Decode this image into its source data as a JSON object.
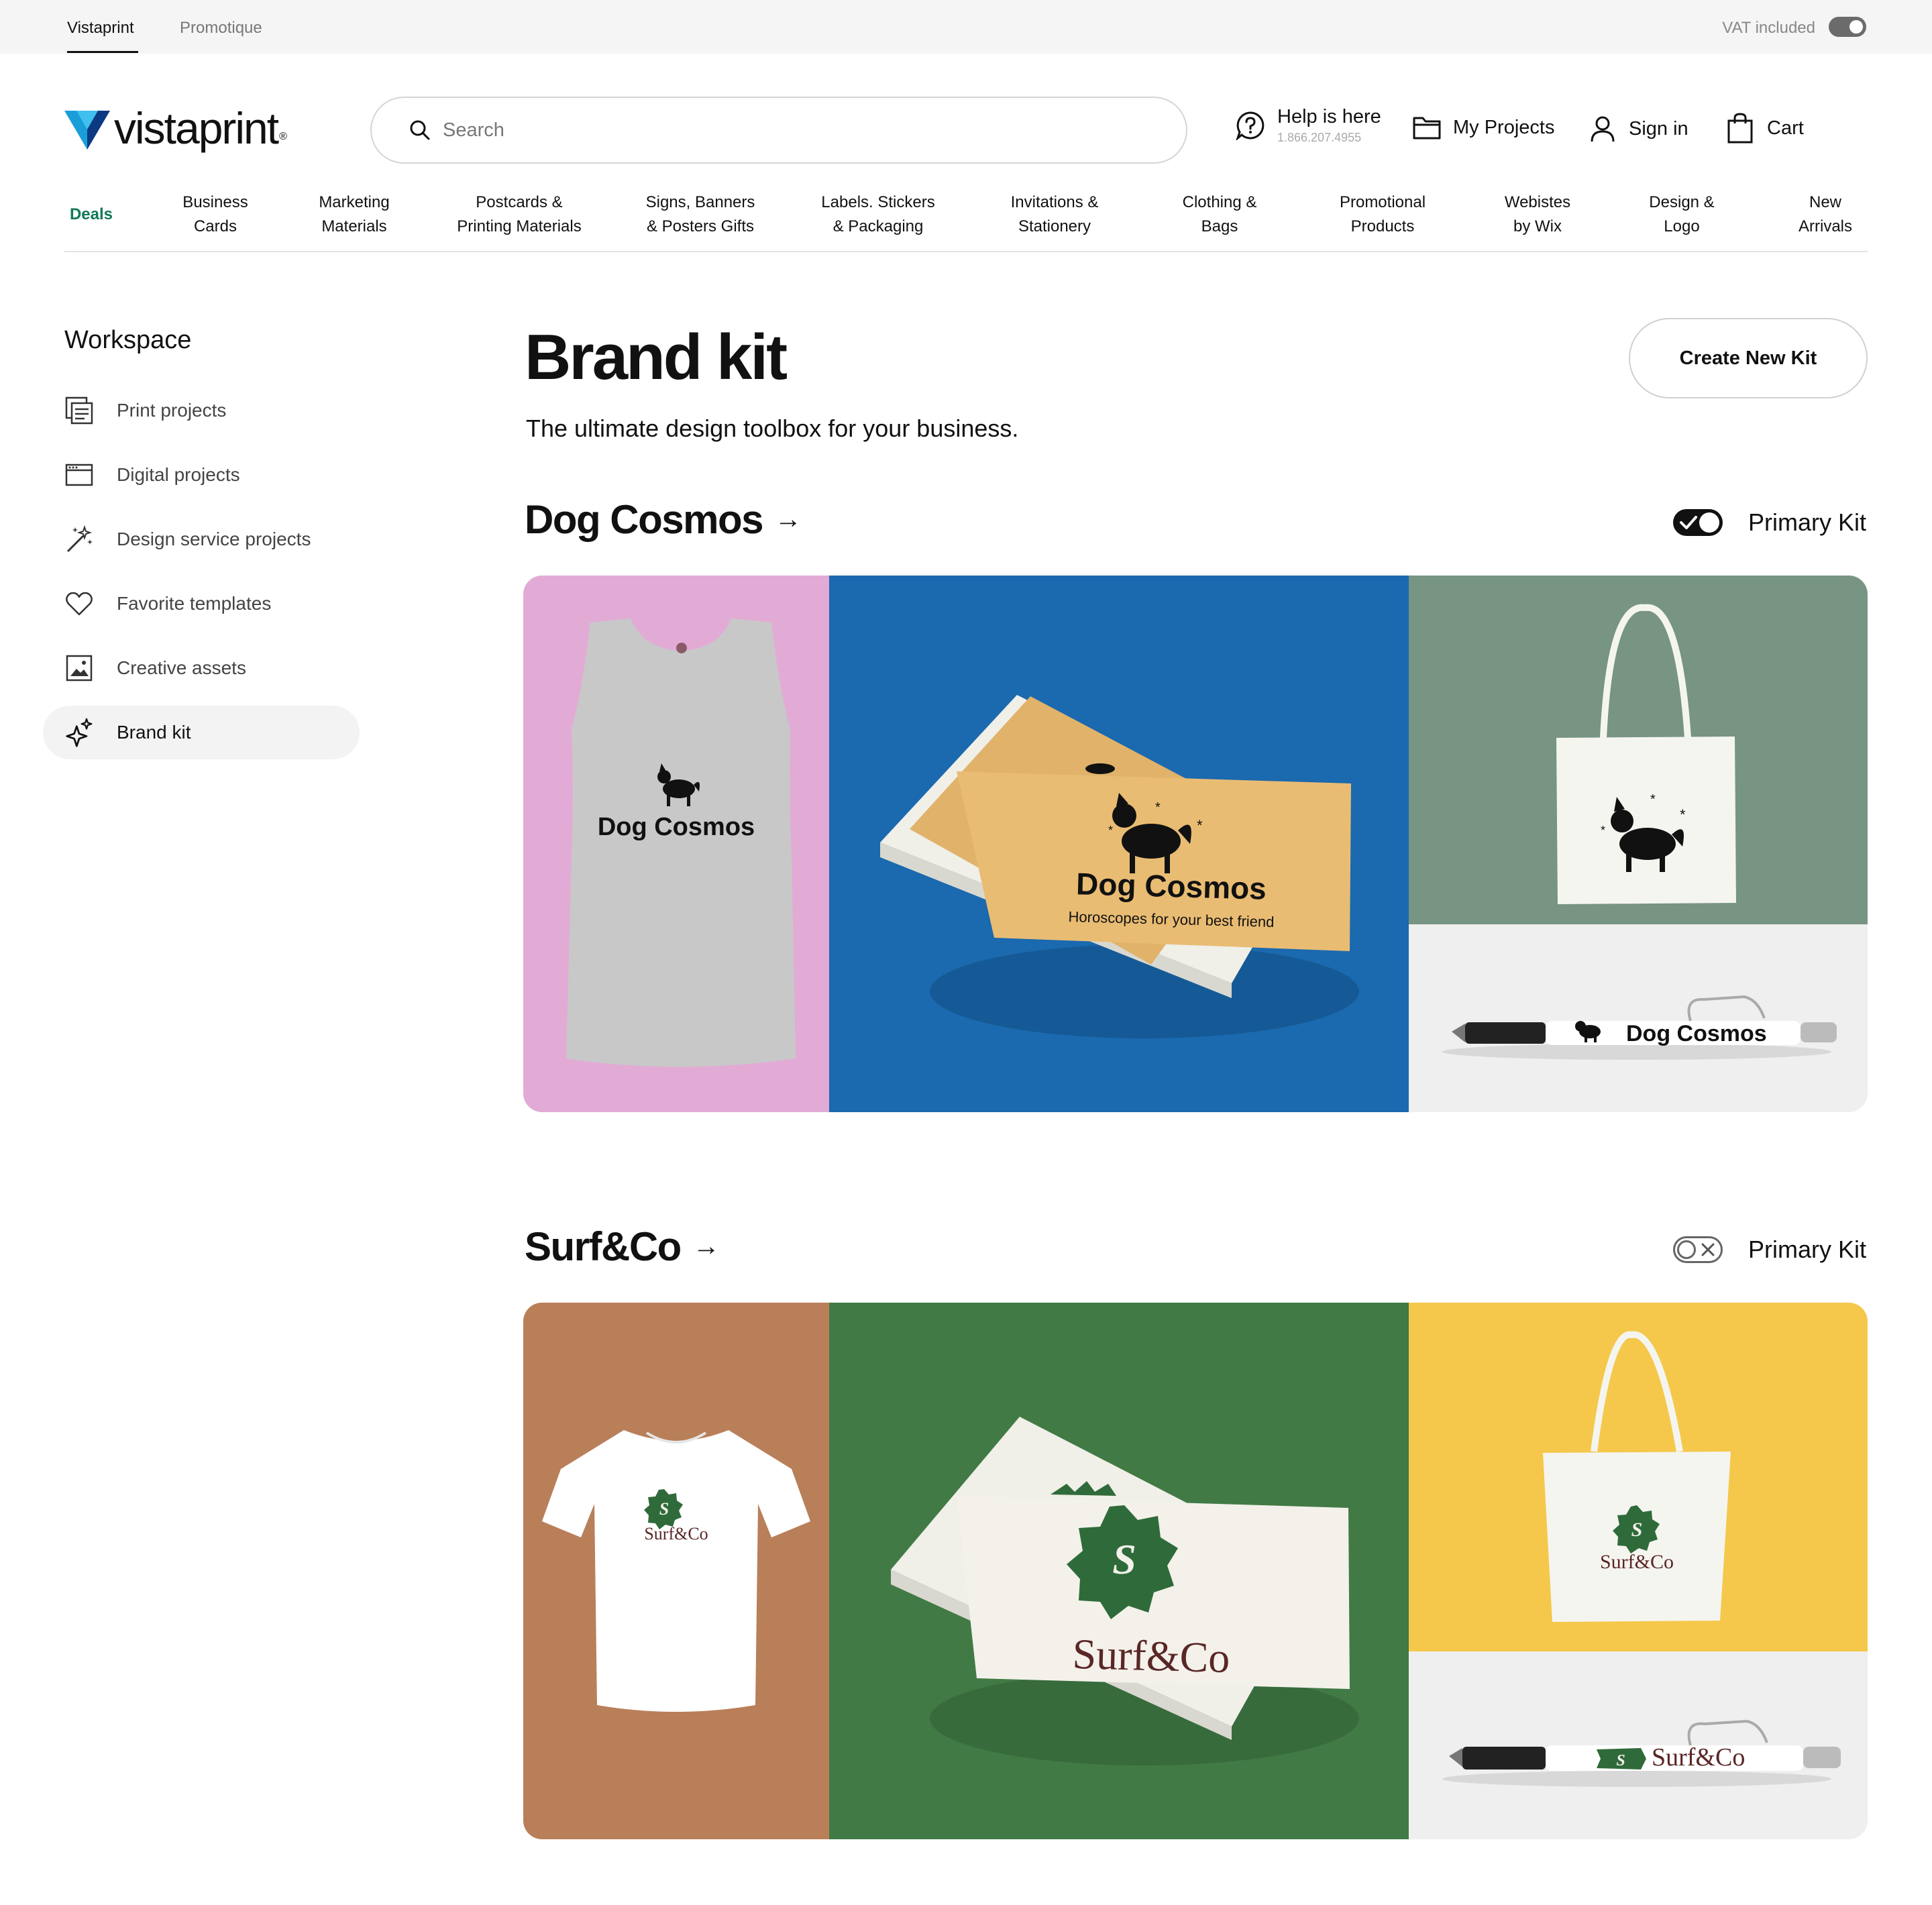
{
  "topbar": {
    "tabs": [
      "Vistaprint",
      "Promotique"
    ],
    "vat_label": "VAT included"
  },
  "header": {
    "logo_text": "vistaprint",
    "logo_reg": "®",
    "search_placeholder": "Search",
    "help_title": "Help is here",
    "help_phone": "1.866.207.4955",
    "my_projects": "My Projects",
    "sign_in": "Sign in",
    "cart": "Cart"
  },
  "nav": {
    "deals": "Deals",
    "items": [
      {
        "line1": "Business",
        "line2": "Cards"
      },
      {
        "line1": "Marketing",
        "line2": "Materials"
      },
      {
        "line1": "Postcards &",
        "line2": "Printing Materials"
      },
      {
        "line1": "Signs, Banners",
        "line2": "& Posters Gifts"
      },
      {
        "line1": "Labels. Stickers",
        "line2": "& Packaging"
      },
      {
        "line1": "Invitations &",
        "line2": "Stationery"
      },
      {
        "line1": "Clothing &",
        "line2": "Bags"
      },
      {
        "line1": "Promotional",
        "line2": "Products"
      },
      {
        "line1": "Webistes",
        "line2": "by Wix"
      },
      {
        "line1": "Design &",
        "line2": "Logo"
      },
      {
        "line1": "New",
        "line2": "Arrivals"
      }
    ]
  },
  "sidebar": {
    "title": "Workspace",
    "items": [
      {
        "label": "Print projects",
        "icon": "print-projects-icon"
      },
      {
        "label": "Digital projects",
        "icon": "browser-window-icon"
      },
      {
        "label": "Design service projects",
        "icon": "magic-wand-icon"
      },
      {
        "label": "Favorite templates",
        "icon": "heart-icon"
      },
      {
        "label": "Creative assets",
        "icon": "image-icon"
      },
      {
        "label": "Brand kit",
        "icon": "sparkle-icon",
        "active": true
      }
    ]
  },
  "main": {
    "title": "Brand kit",
    "subtitle": "The ultimate design toolbox for your business.",
    "create_button": "Create New Kit",
    "kits": [
      {
        "name": "Dog Cosmos",
        "arrow": "→",
        "primary_label": "Primary Kit",
        "primary": true,
        "tagline": "Horoscopes for your best friend",
        "colors": {
          "panel1": "#e2abd6",
          "panel2": "#1b69ae",
          "panel3": "#789483",
          "panel4": "#efefef",
          "card": "#e9bc73"
        }
      },
      {
        "name": "Surf&Co",
        "arrow": "→",
        "primary_label": "Primary Kit",
        "primary": false,
        "logo_letter": "S",
        "colors": {
          "panel1": "#b97f59",
          "panel2": "#417a45",
          "panel3": "#f5c84c",
          "panel4": "#efefef",
          "card": "#f3f1ea",
          "brand": "#2f6b3a",
          "text": "#5a2626"
        }
      }
    ]
  }
}
